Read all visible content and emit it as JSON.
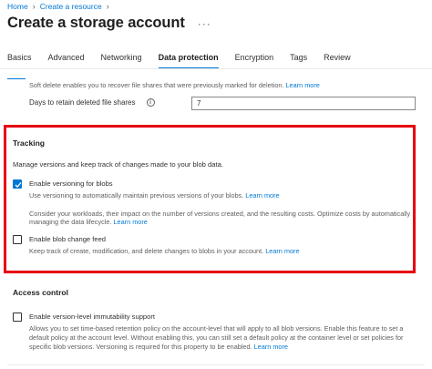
{
  "breadcrumb": {
    "home": "Home",
    "create": "Create a resource"
  },
  "page": {
    "title": "Create a storage account",
    "more": "···"
  },
  "tabs": [
    "Basics",
    "Advanced",
    "Networking",
    "Data protection",
    "Encryption",
    "Tags",
    "Review"
  ],
  "soft_delete": {
    "description": "Soft delete enables you to recover file shares that were previously marked for deletion.",
    "learn_more": "Learn more",
    "retain_label": "Days to retain deleted file shares",
    "retain_value": "7"
  },
  "tracking": {
    "heading": "Tracking",
    "description": "Manage versions and keep track of changes made to your blob data.",
    "versioning": {
      "label": "Enable versioning for blobs",
      "checked": true,
      "description": "Use versioning to automatically maintain previous versions of your blobs.",
      "learn_more": "Learn more",
      "note_line1": "Consider your workloads, their impact on the number of versions created, and the resulting costs. Optimize costs by automatically",
      "note_line2": "managing the data lifecycle.",
      "note_learn_more": "Learn more"
    },
    "change_feed": {
      "label": "Enable blob change feed",
      "checked": false,
      "description": "Keep track of create, modification, and delete changes to blobs in your account.",
      "learn_more": "Learn more"
    }
  },
  "access_control": {
    "heading": "Access control",
    "immutability": {
      "label": "Enable version-level immutability support",
      "checked": false,
      "line1": "Allows you to set time-based retention policy on the account-level that will apply to all blob versions. Enable this feature to set a",
      "line2": "default policy at the account level. Without enabling this, you can still set a default policy at the container level or set policies for",
      "line3": "specific blob versions. Versioning is required for this property to be enabled.",
      "learn_more": "Learn more"
    }
  },
  "colors": {
    "accent": "#0078d4",
    "highlight": "#e60012"
  }
}
